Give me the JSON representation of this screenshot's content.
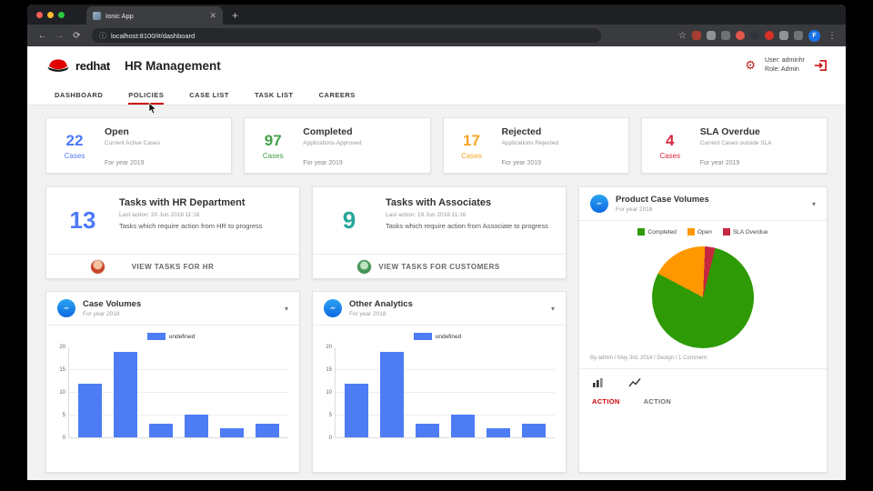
{
  "browser": {
    "tab_title": "Ionic App",
    "url": "localhost:8100/#/dashboard",
    "profile_initial": "F",
    "extension_colors": [
      "#a73c32",
      "#8f9398",
      "#6f7378",
      "#e2574c",
      "#30333c",
      "#d93025",
      "#8f9398",
      "#6f7378"
    ]
  },
  "header": {
    "brand": "redhat",
    "title": "HR Management",
    "user": "User: adminhr",
    "role": "Role: Admin"
  },
  "nav": {
    "items": [
      "DASHBOARD",
      "POLICIES",
      "CASE LIST",
      "TASK LIST",
      "CAREERS"
    ],
    "active": "POLICIES"
  },
  "stat_cards": [
    {
      "value": "22",
      "unit": "Cases",
      "color": "#4d79f6",
      "title": "Open",
      "subtitle": "Current Active Cases",
      "period": "For year 2019"
    },
    {
      "value": "97",
      "unit": "Cases",
      "color": "#43a047",
      "title": "Completed",
      "subtitle": "Applications Approved",
      "period": "For year 2019"
    },
    {
      "value": "17",
      "unit": "Cases",
      "color": "#f5a623",
      "title": "Rejected",
      "subtitle": "Applications Rejected",
      "period": "For year 2019"
    },
    {
      "value": "4",
      "unit": "Cases",
      "color": "#d7263d",
      "title": "SLA Overdue",
      "subtitle": "Current Cases outside SLA",
      "period": "For year 2019"
    }
  ],
  "task_cards": [
    {
      "value": "13",
      "color": "#4d79f6",
      "title": "Tasks with HR Department",
      "last_action": "Last action: 20 Jun 2018 11:16",
      "description": "Tasks which require action from HR to progress",
      "button": "VIEW TASKS FOR HR"
    },
    {
      "value": "9",
      "color": "#26a69a",
      "title": "Tasks with Associates",
      "last_action": "Last action: 19 Jun 2018 11:16",
      "description": "Tasks which require action from Associate to progress",
      "button": "VIEW TASKS FOR CUSTOMERS"
    }
  ],
  "pie_card": {
    "title": "Product Case Volumes",
    "subtitle": "For year 2018",
    "meta": "By admin / May 3rd, 2014 / Design / 1 Comment",
    "actions": [
      {
        "label": "ACTION",
        "color": "#cc0000"
      },
      {
        "label": "ACTION",
        "color": "#6f6f6f"
      }
    ],
    "chart_data": {
      "type": "pie",
      "labels": [
        "Completed",
        "Open",
        "SLA Overdue"
      ],
      "values": [
        97,
        22,
        4
      ],
      "colors": [
        "#2e9b06",
        "#ff9800",
        "#c62841"
      ],
      "start_angle": 14,
      "legend_position": "top"
    }
  },
  "bar_cards": [
    {
      "title": "Case Volumes",
      "subtitle": "For year 2018",
      "chart_data": {
        "type": "bar",
        "series_label": "undefined",
        "categories": [
          "",
          "",
          "",
          "",
          "",
          ""
        ],
        "values": [
          12,
          19,
          3,
          5,
          2,
          3
        ],
        "bar_color": "#4e7cf5",
        "ylim": [
          0,
          20
        ],
        "yticks": [
          0,
          5,
          10,
          15,
          20
        ],
        "grid": true
      }
    },
    {
      "title": "Other Analytics",
      "subtitle": "For year 2018",
      "chart_data": {
        "type": "bar",
        "series_label": "undefined",
        "categories": [
          "",
          "",
          "",
          "",
          "",
          ""
        ],
        "values": [
          12,
          19,
          3,
          5,
          2,
          3
        ],
        "bar_color": "#4e7cf5",
        "ylim": [
          0,
          20
        ],
        "yticks": [
          0,
          5,
          10,
          15,
          20
        ],
        "grid": true
      }
    }
  ]
}
